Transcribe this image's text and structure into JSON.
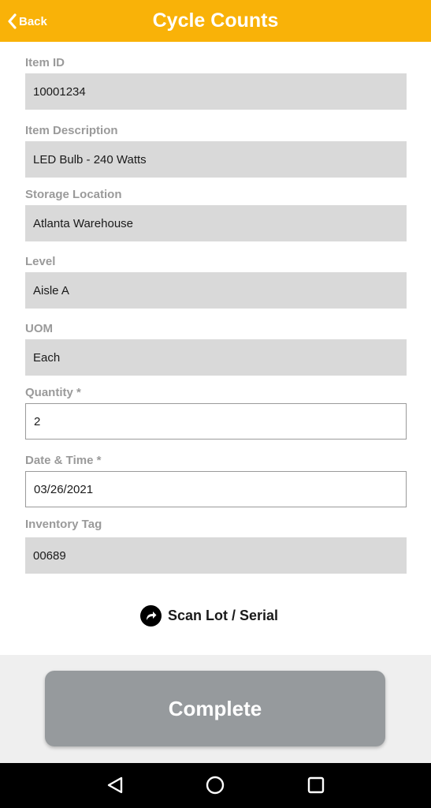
{
  "header": {
    "back_label": "Back",
    "title": "Cycle Counts",
    "background_color": "#f9b208"
  },
  "fields": [
    {
      "label": "Item ID",
      "value": "10001234",
      "editable": false
    },
    {
      "label": "Item Description",
      "value": "LED Bulb - 240 Watts",
      "editable": false
    },
    {
      "label": "Storage Location",
      "value": "Atlanta Warehouse",
      "editable": false
    },
    {
      "label": "Level",
      "value": "Aisle A",
      "editable": false
    },
    {
      "label": "UOM",
      "value": "Each",
      "editable": false
    },
    {
      "label": "Quantity *",
      "value": "2",
      "editable": true
    },
    {
      "label": "Date & Time *",
      "value": "03/26/2021",
      "editable": true
    },
    {
      "label": "Inventory Tag",
      "value": "00689",
      "editable": false
    }
  ],
  "scan_link": {
    "label": "Scan Lot / Serial",
    "icon": "share-arrow-icon"
  },
  "footer": {
    "complete_label": "Complete",
    "button_color": "#969a9d"
  },
  "navbar": {
    "icons": [
      "back-triangle-icon",
      "home-circle-icon",
      "recents-square-icon"
    ]
  }
}
